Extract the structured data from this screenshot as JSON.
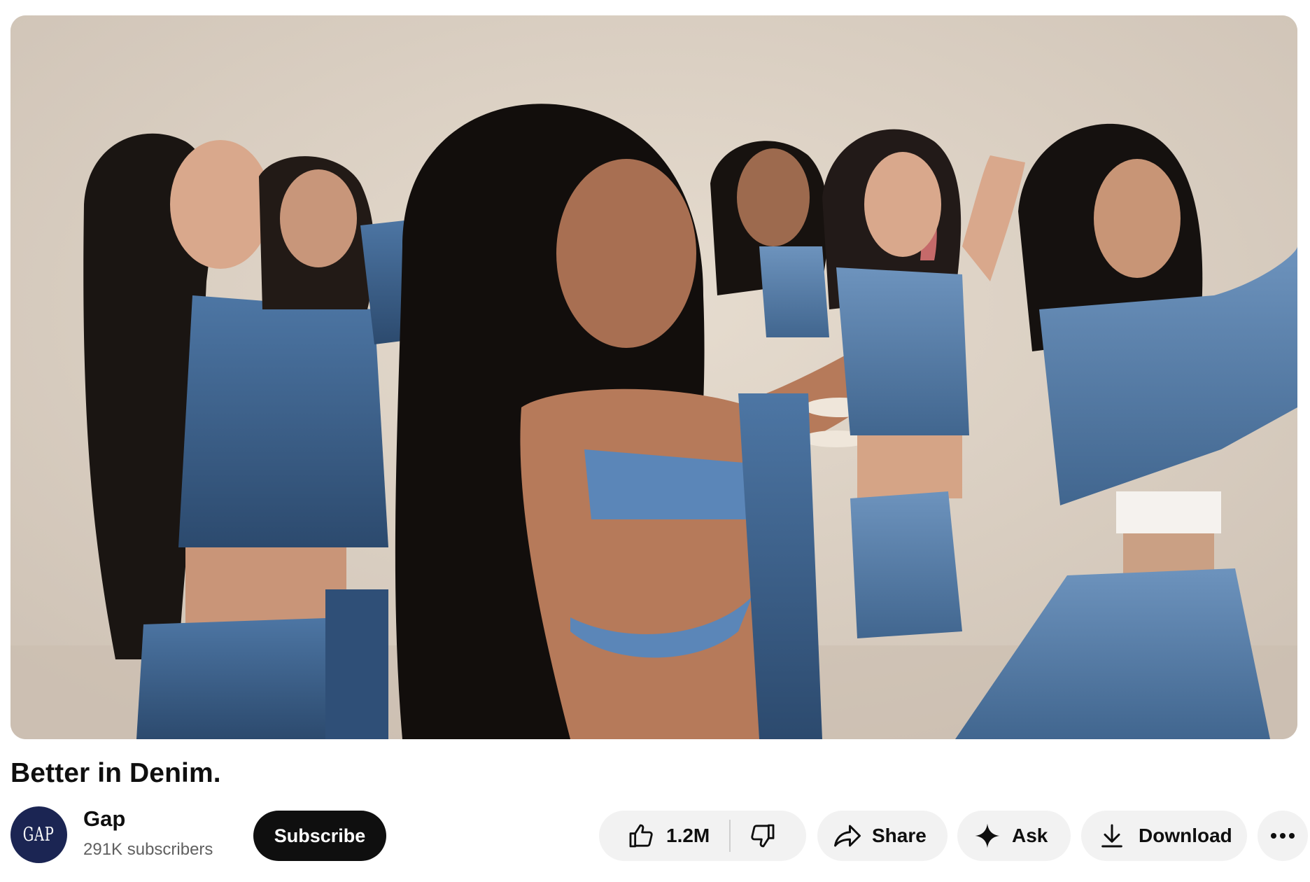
{
  "video": {
    "title": "Better in Denim."
  },
  "channel": {
    "avatar_text": "GAP",
    "name": "Gap",
    "subscribers": "291K subscribers"
  },
  "actions": {
    "subscribe": "Subscribe",
    "like_count": "1.2M",
    "share": "Share",
    "ask": "Ask",
    "download": "Download"
  },
  "icons": {
    "like": "thumbs-up-icon",
    "dislike": "thumbs-down-icon",
    "share": "share-arrow-icon",
    "ask": "sparkle-icon",
    "download": "download-icon",
    "more": "more-horizontal-icon"
  },
  "colors": {
    "backdrop": "#d8cdc2",
    "denim": "#3d5e85",
    "subscribe_bg": "#0f0f0f",
    "pill_bg": "#f2f2f2",
    "avatar_bg": "#1b2553"
  }
}
